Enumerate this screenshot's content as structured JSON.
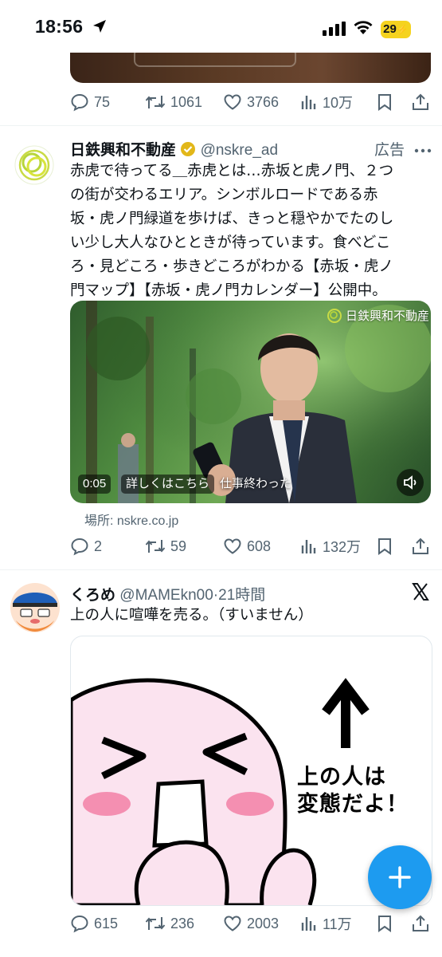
{
  "status_bar": {
    "time": "18:56",
    "battery": "29"
  },
  "tweets": [
    {
      "actions": {
        "replies": "75",
        "retweets": "1061",
        "likes": "3766",
        "views": "10万"
      }
    },
    {
      "display_name": "日鉄興和不動産",
      "handle": "@nskre_ad",
      "ad_label": "広告",
      "text_lines": [
        "赤虎で待ってる＿赤虎とは…赤坂と虎ノ門、２つ",
        "の街が交わるエリア。シンボルロードである赤",
        "坂・虎ノ門緑道を歩けば、きっと穏やかでたのし",
        "い少し大人なひとときが待っています。食べどこ",
        "ろ・見どころ・歩きどころがわかる【赤坂・虎ノ",
        "門マップ】【赤坂・虎ノ門カレンダー】公開中。"
      ],
      "video": {
        "brand_watermark": "日鉄興和不動産",
        "time": "0:05",
        "cta": "詳しくはこちら",
        "subtitle": "仕事終わった"
      },
      "location": "場所: nskre.co.jp",
      "actions": {
        "replies": "2",
        "retweets": "59",
        "likes": "608",
        "views": "132万"
      }
    },
    {
      "display_name": "くろめ",
      "handle": "@MAMEkn00",
      "time": "·21時間",
      "text": "上の人に喧嘩を売る。（すいません）",
      "image_text": [
        "上の人は",
        "変態だよ！"
      ],
      "actions": {
        "replies": "615",
        "retweets": "236",
        "likes": "2003",
        "views": "11万"
      }
    }
  ],
  "colors": {
    "accent": "#1d9bf0",
    "muted": "#536471",
    "verified": "#e2b719"
  }
}
